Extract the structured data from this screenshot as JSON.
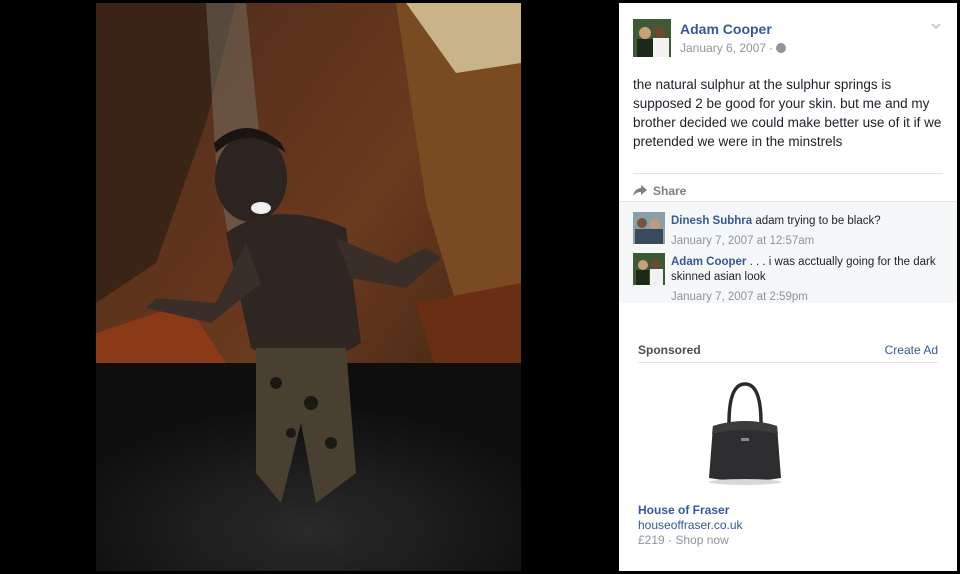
{
  "photo": {
    "description_icon": "photo-image"
  },
  "post": {
    "author": "Adam Cooper",
    "date": "January 6, 2007",
    "separator": "·",
    "privacy_icon": "globe-icon",
    "menu_icon": "chevron-down-icon",
    "text": "the natural sulphur at the sulphur springs is supposed 2 be good for your skin. but me and my brother decided we could make better use of it if we pretended we were in the minstrels"
  },
  "actions": {
    "share_label": "Share",
    "share_icon": "share-arrow-icon"
  },
  "comments": [
    {
      "name": "Dinesh Subhra",
      "text": "adam trying to be black?",
      "time": "January 7, 2007 at 12:57am"
    },
    {
      "name": "Adam Cooper",
      "text": ". . . i was acctually going for the dark skinned asian look",
      "time": "January 7, 2007 at 2:59pm"
    }
  ],
  "sponsored": {
    "label": "Sponsored",
    "create_ad": "Create Ad",
    "ad": {
      "title": "House of Fraser",
      "url": "houseoffraser.co.uk",
      "price": "£219 · Shop now"
    }
  },
  "colors": {
    "link": "#365899",
    "muted": "#90949c",
    "comment_bg": "#f6f7f9"
  }
}
